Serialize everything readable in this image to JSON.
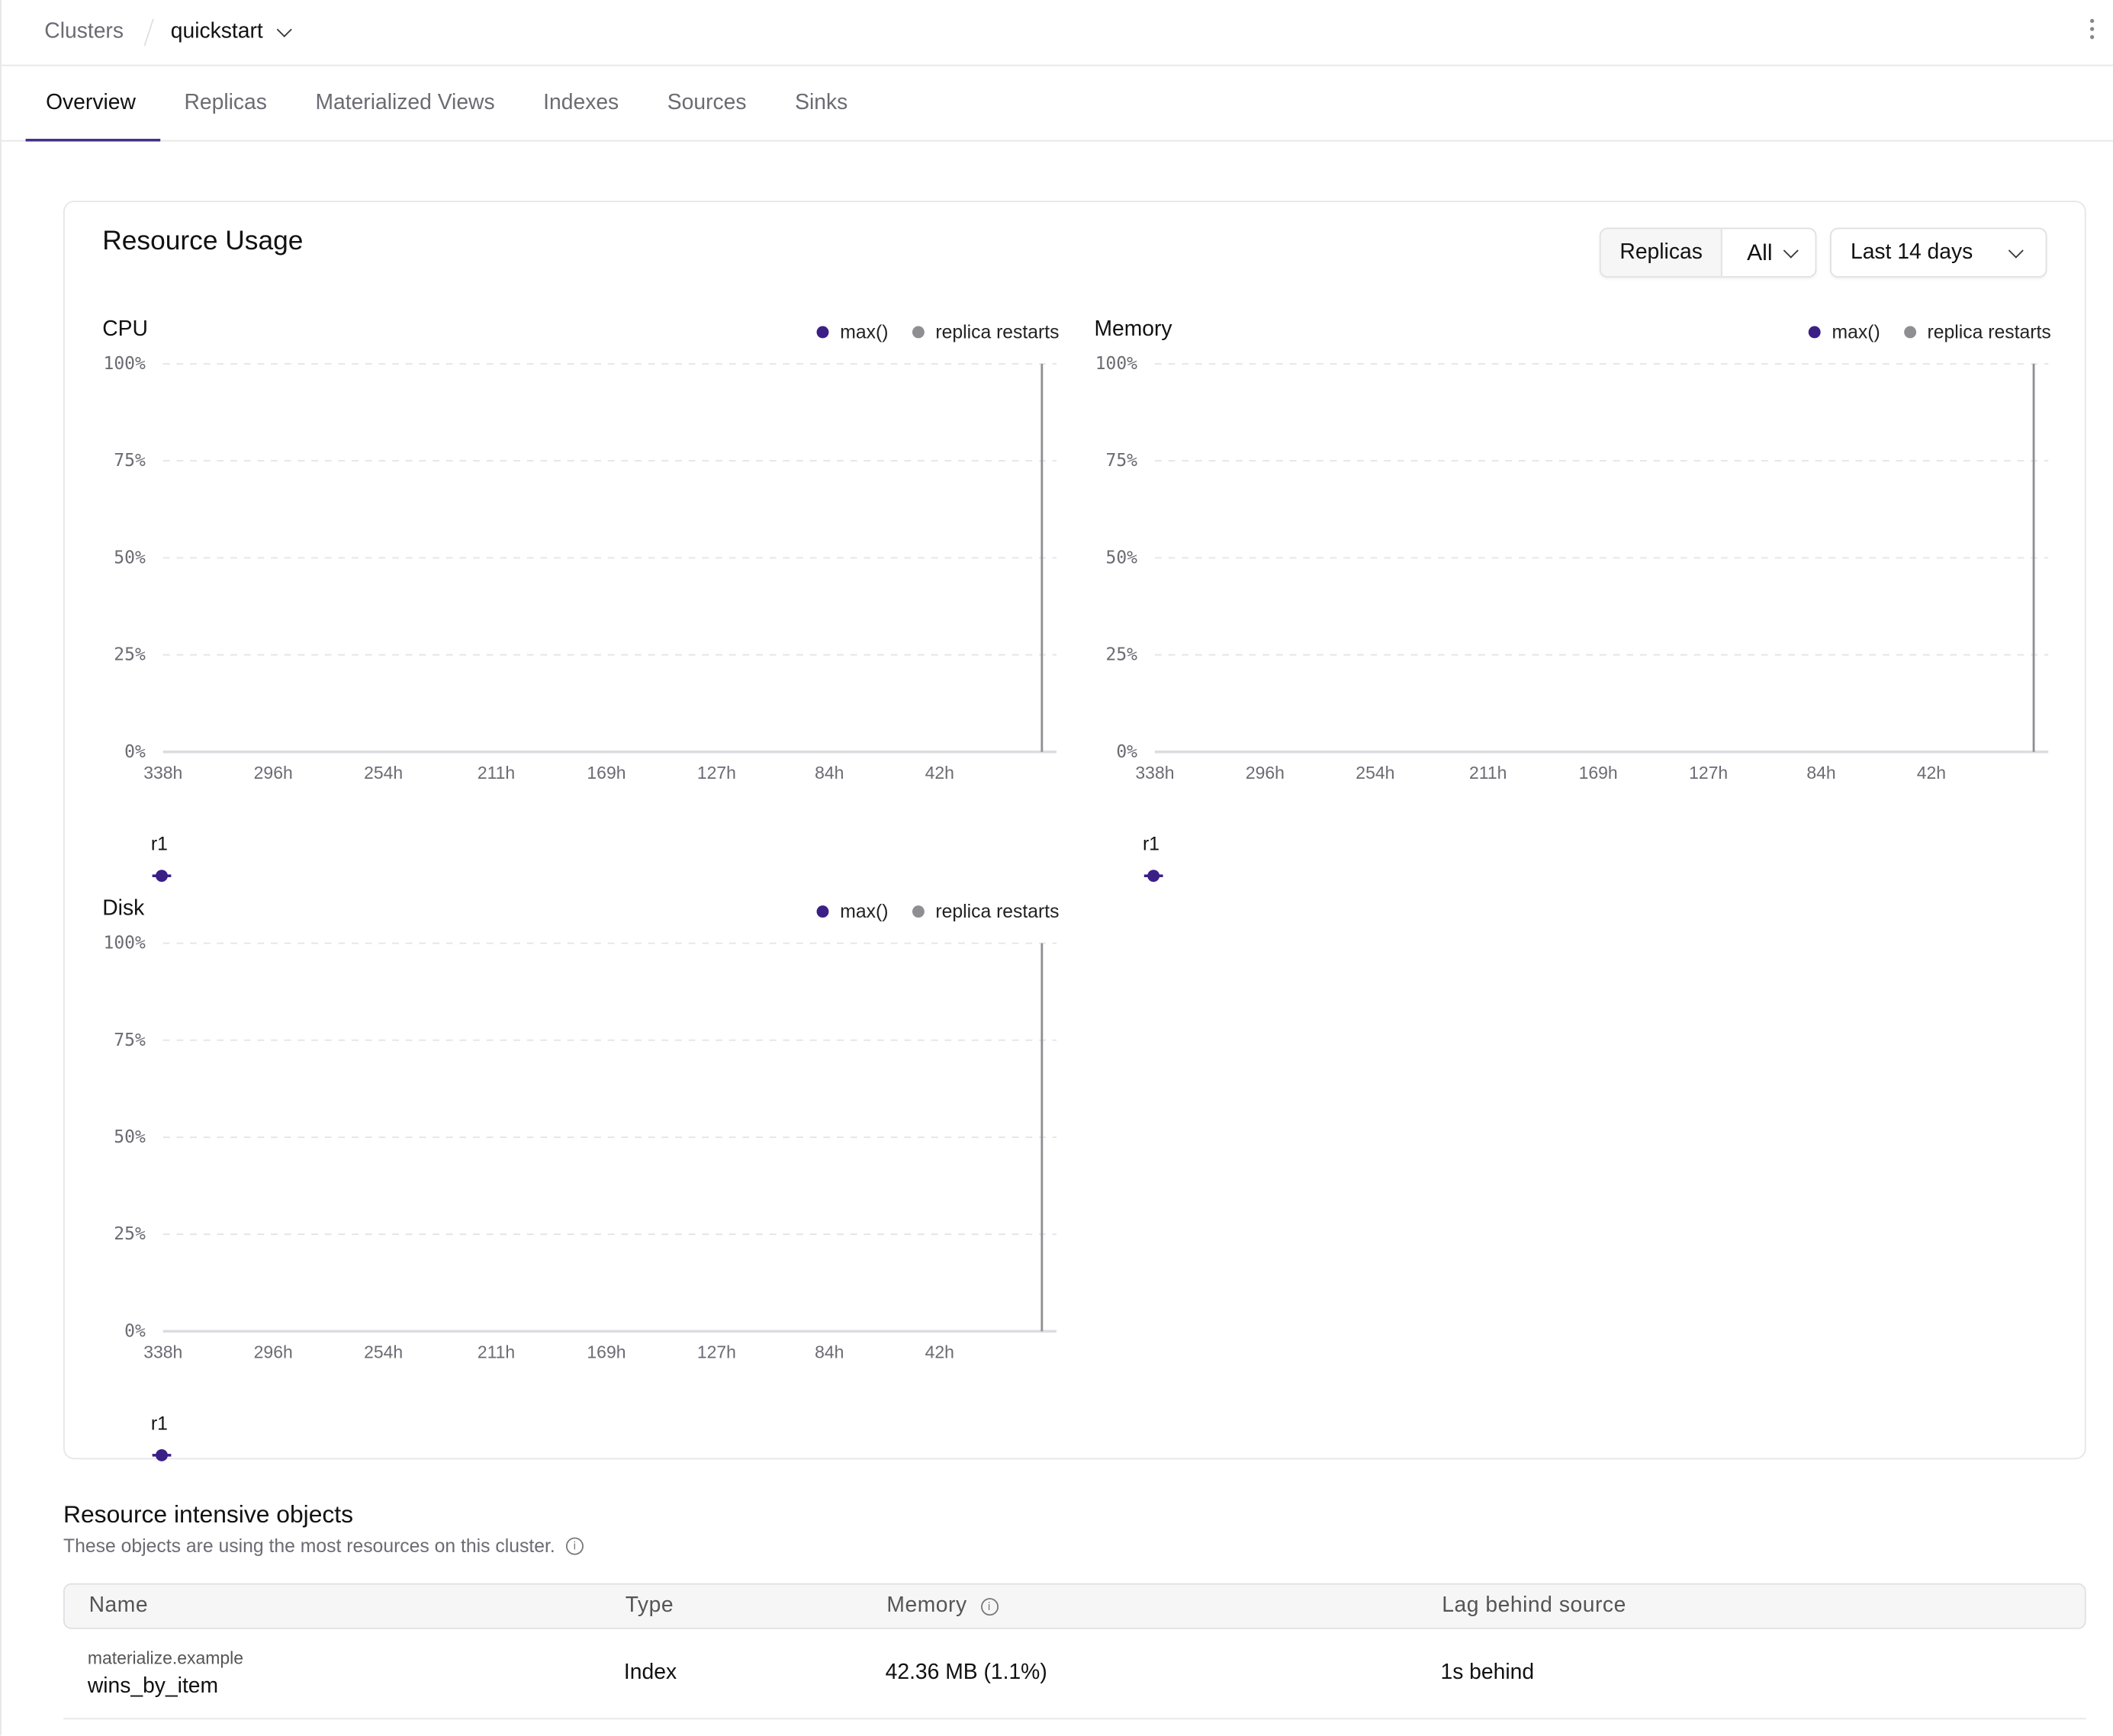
{
  "breadcrumb": {
    "root": "Clusters",
    "current": "quickstart"
  },
  "tabs": [
    {
      "label": "Overview",
      "active": true
    },
    {
      "label": "Replicas",
      "active": false
    },
    {
      "label": "Materialized Views",
      "active": false
    },
    {
      "label": "Indexes",
      "active": false
    },
    {
      "label": "Sources",
      "active": false
    },
    {
      "label": "Sinks",
      "active": false
    }
  ],
  "resource_usage": {
    "title": "Resource Usage",
    "replicas_label": "Replicas",
    "replicas_value": "All",
    "time_range": "Last 14 days"
  },
  "colors": {
    "accent": "#472f85",
    "series": "#3b1f86",
    "restart": "#8e8e93"
  },
  "chart_data": [
    {
      "type": "line",
      "title": "CPU",
      "legend": [
        "max()",
        "replica restarts"
      ],
      "yticks": [
        "0%",
        "25%",
        "50%",
        "75%",
        "100%"
      ],
      "ylim": [
        0,
        100
      ],
      "xticks": [
        "338h",
        "296h",
        "254h",
        "211h",
        "169h",
        "127h",
        "84h",
        "42h"
      ],
      "xlim_hours_ago": [
        338,
        0
      ],
      "series": [
        {
          "name": "r1",
          "values": []
        }
      ],
      "replica_restarts_hours_ago": [
        3
      ]
    },
    {
      "type": "line",
      "title": "Memory",
      "legend": [
        "max()",
        "replica restarts"
      ],
      "yticks": [
        "0%",
        "25%",
        "50%",
        "75%",
        "100%"
      ],
      "ylim": [
        0,
        100
      ],
      "xticks": [
        "338h",
        "296h",
        "254h",
        "211h",
        "169h",
        "127h",
        "84h",
        "42h"
      ],
      "xlim_hours_ago": [
        338,
        0
      ],
      "series": [
        {
          "name": "r1",
          "values": []
        }
      ],
      "replica_restarts_hours_ago": [
        3
      ]
    },
    {
      "type": "line",
      "title": "Disk",
      "legend": [
        "max()",
        "replica restarts"
      ],
      "yticks": [
        "0%",
        "25%",
        "50%",
        "75%",
        "100%"
      ],
      "ylim": [
        0,
        100
      ],
      "xticks": [
        "338h",
        "296h",
        "254h",
        "211h",
        "169h",
        "127h",
        "84h",
        "42h"
      ],
      "xlim_hours_ago": [
        338,
        0
      ],
      "series": [
        {
          "name": "r1",
          "values": []
        }
      ],
      "replica_restarts_hours_ago": [
        3
      ]
    }
  ],
  "resource_objects": {
    "title": "Resource intensive objects",
    "subtitle": "These objects are using the most resources on this cluster.",
    "columns": [
      "Name",
      "Type",
      "Memory",
      "Lag behind source"
    ],
    "rows": [
      {
        "schema": "materialize.example",
        "name": "wins_by_item",
        "type": "Index",
        "memory": "42.36 MB (1.1%)",
        "lag": "1s behind"
      }
    ]
  }
}
